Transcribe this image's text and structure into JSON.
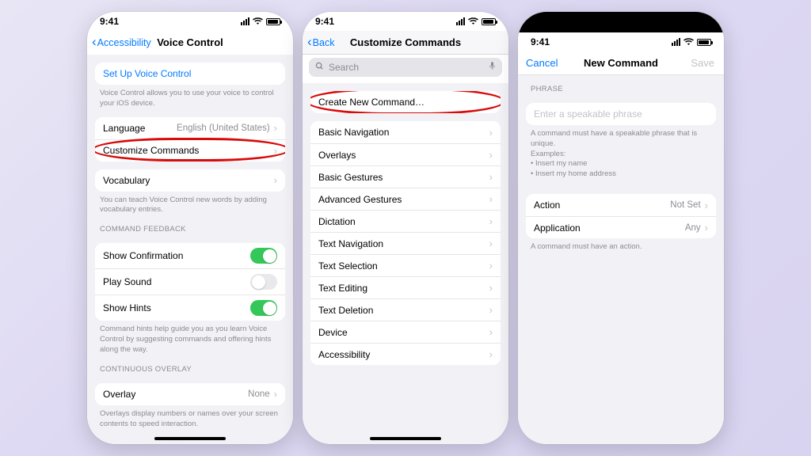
{
  "status": {
    "time": "9:41"
  },
  "phone1": {
    "nav": {
      "back": "Accessibility",
      "title": "Voice Control"
    },
    "setup_row": "Set Up Voice Control",
    "setup_footer": "Voice Control allows you to use your voice to control your iOS device.",
    "language_label": "Language",
    "language_value": "English (United States)",
    "customize_label": "Customize Commands",
    "vocabulary_label": "Vocabulary",
    "vocabulary_footer": "You can teach Voice Control new words by adding vocabulary entries.",
    "section_feedback": "COMMAND FEEDBACK",
    "show_confirmation": "Show Confirmation",
    "play_sound": "Play Sound",
    "show_hints": "Show Hints",
    "hints_footer": "Command hints help guide you as you learn Voice Control by suggesting commands and offering hints along the way.",
    "section_overlay": "CONTINUOUS OVERLAY",
    "overlay_label": "Overlay",
    "overlay_value": "None",
    "overlay_footer": "Overlays display numbers or names over your screen contents to speed interaction."
  },
  "phone2": {
    "nav": {
      "back": "Back",
      "title": "Customize Commands"
    },
    "search_placeholder": "Search",
    "create_label": "Create New Command…",
    "categories": [
      "Basic Navigation",
      "Overlays",
      "Basic Gestures",
      "Advanced Gestures",
      "Dictation",
      "Text Navigation",
      "Text Selection",
      "Text Editing",
      "Text Deletion",
      "Device",
      "Accessibility"
    ]
  },
  "phone3": {
    "nav": {
      "cancel": "Cancel",
      "title": "New Command",
      "save": "Save"
    },
    "section_phrase": "PHRASE",
    "phrase_placeholder": "Enter a speakable phrase",
    "phrase_footer1": "A command must have a speakable phrase that is unique.",
    "phrase_footer2": "Examples:",
    "phrase_footer3": "• Insert my name",
    "phrase_footer4": "• Insert my home address",
    "action_label": "Action",
    "action_value": "Not Set",
    "app_label": "Application",
    "app_value": "Any",
    "action_footer": "A command must have an action."
  }
}
